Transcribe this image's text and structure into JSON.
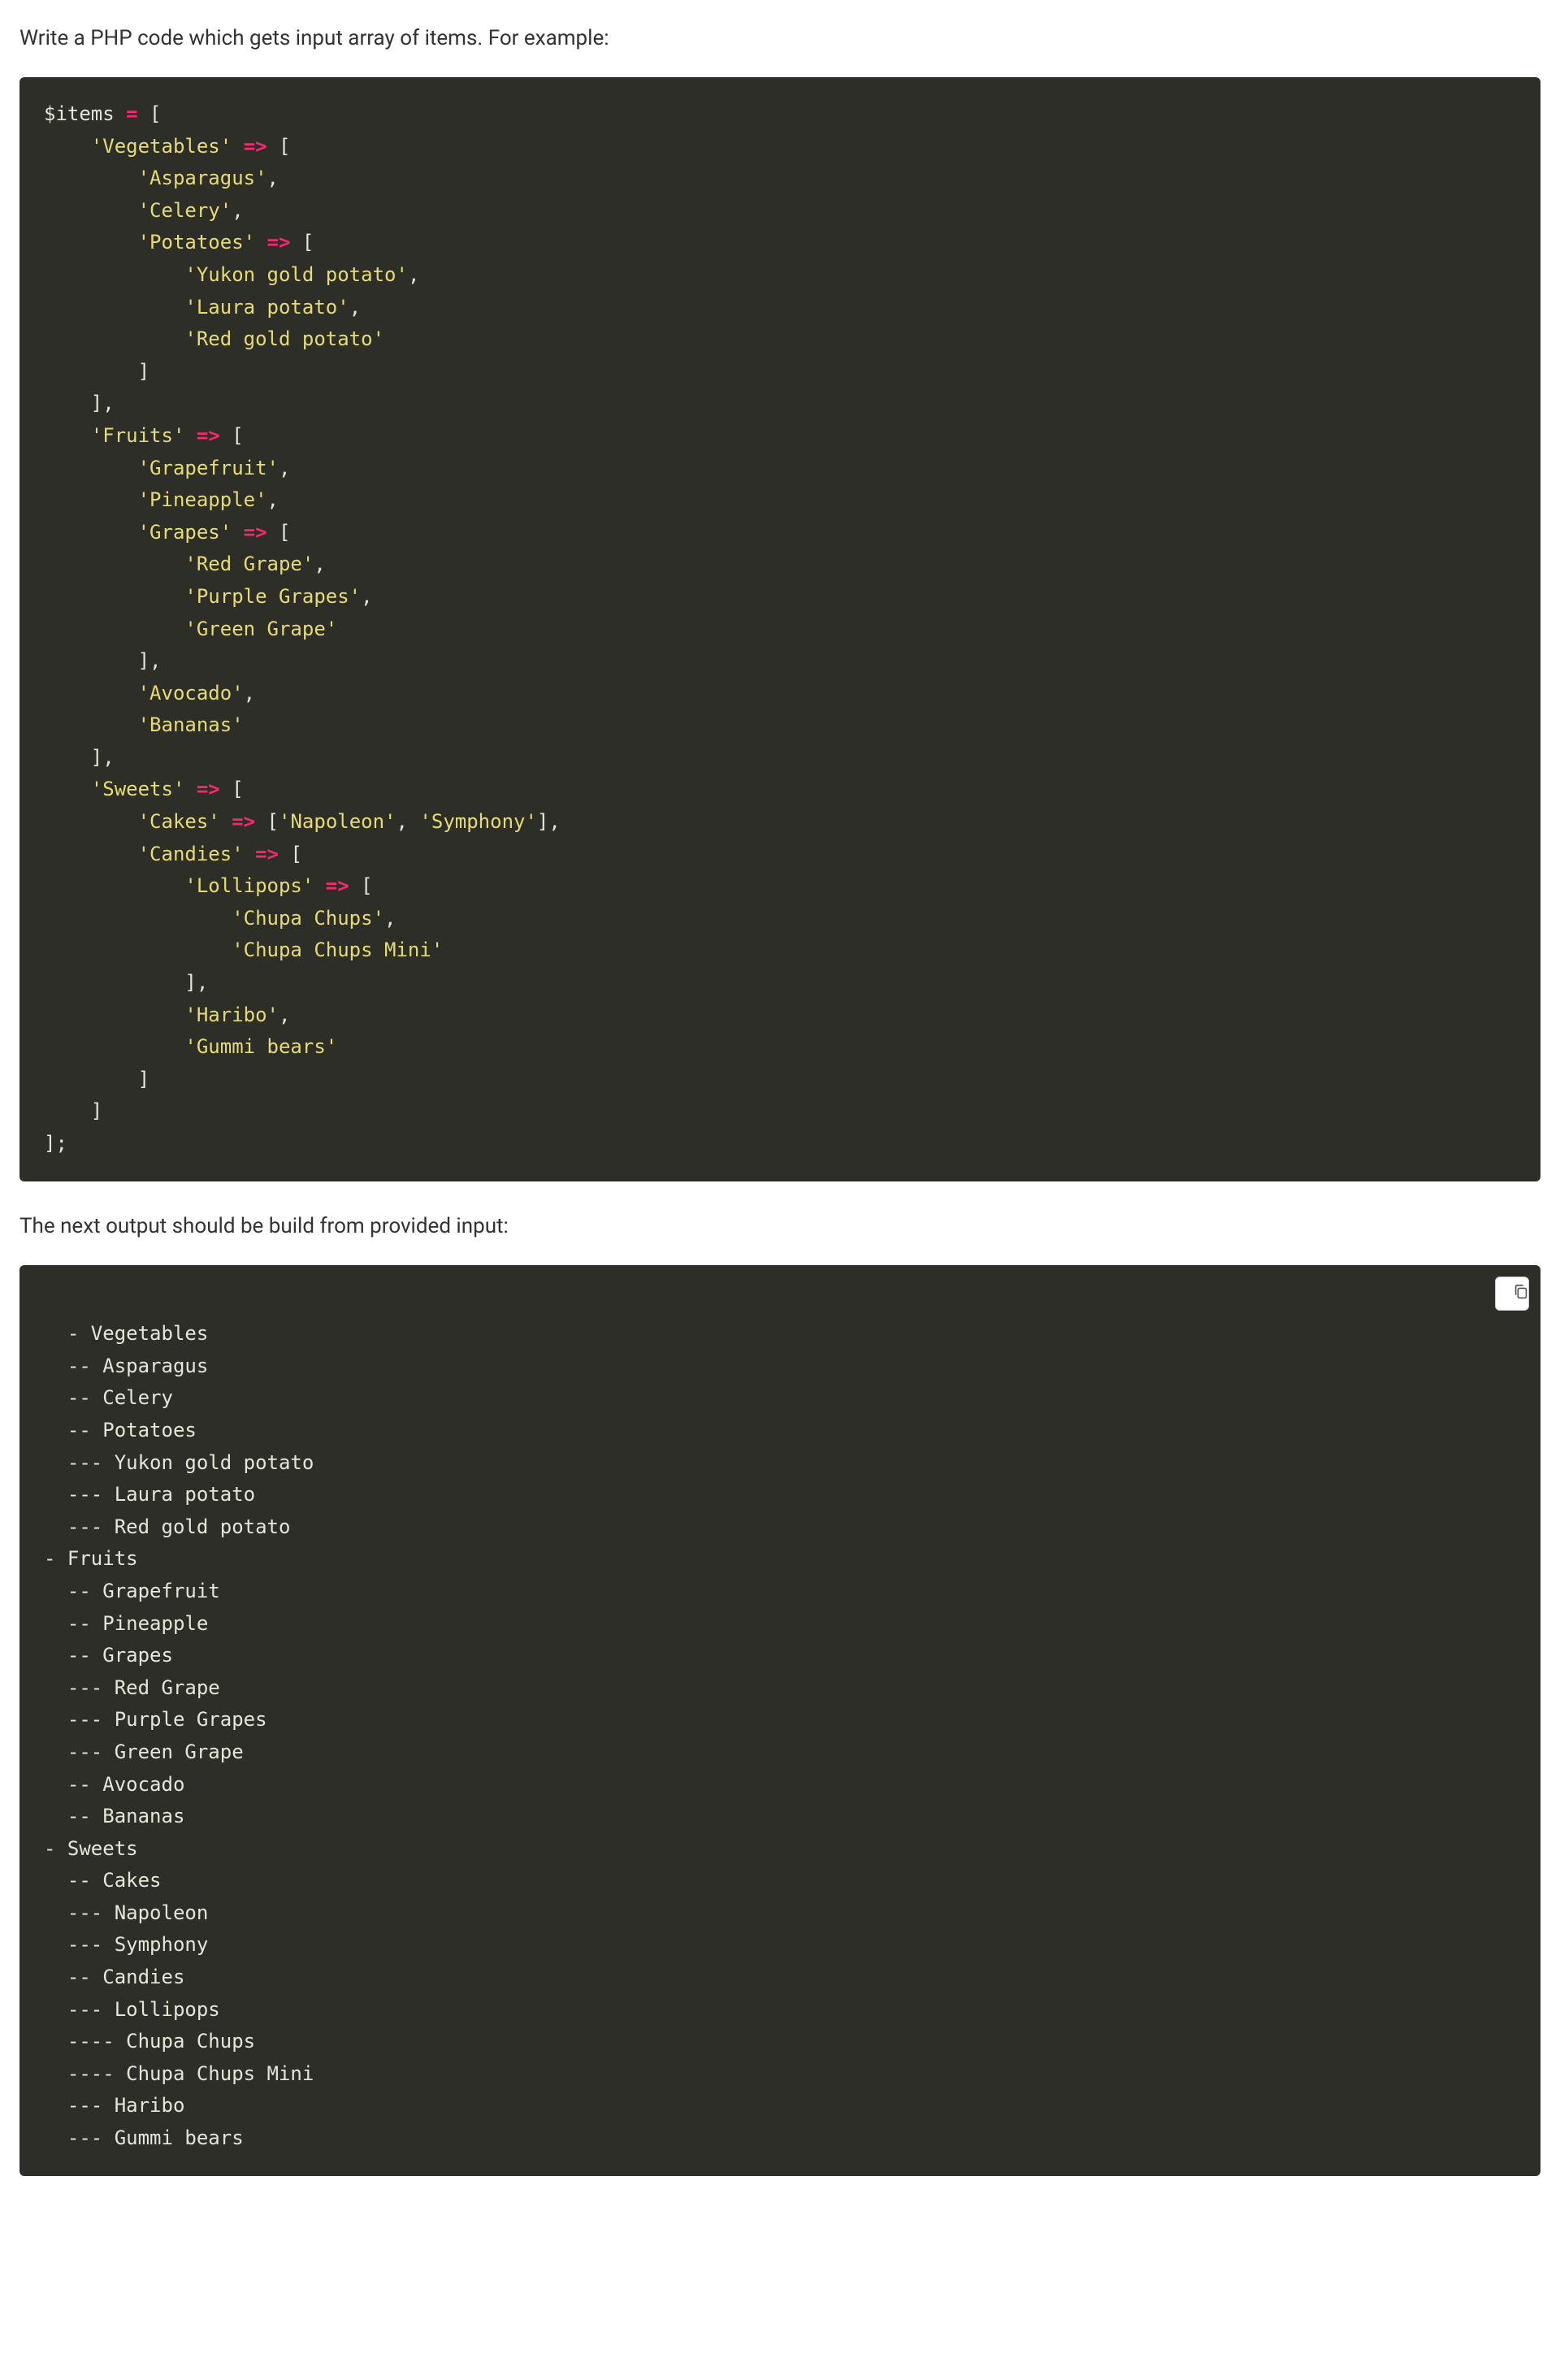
{
  "instruction_top": "Write a PHP code which gets input array of items. For example:",
  "instruction_mid": "The next output should be build from provided input:",
  "copy_button_label": "Copy",
  "code_block_1_tokens": [
    [
      "var",
      "$items"
    ],
    [
      "punct",
      " "
    ],
    [
      "eq",
      "="
    ],
    [
      "punct",
      " ["
    ],
    [
      "punct",
      "\n"
    ],
    [
      "punct",
      "    "
    ],
    [
      "str",
      "'Vegetables'"
    ],
    [
      "punct",
      " "
    ],
    [
      "arrow",
      "=>"
    ],
    [
      "punct",
      " ["
    ],
    [
      "punct",
      "\n"
    ],
    [
      "punct",
      "        "
    ],
    [
      "str",
      "'Asparagus'"
    ],
    [
      "punct",
      ","
    ],
    [
      "punct",
      "\n"
    ],
    [
      "punct",
      "        "
    ],
    [
      "str",
      "'Celery'"
    ],
    [
      "punct",
      ","
    ],
    [
      "punct",
      "\n"
    ],
    [
      "punct",
      "        "
    ],
    [
      "str",
      "'Potatoes'"
    ],
    [
      "punct",
      " "
    ],
    [
      "arrow",
      "=>"
    ],
    [
      "punct",
      " ["
    ],
    [
      "punct",
      "\n"
    ],
    [
      "punct",
      "            "
    ],
    [
      "str",
      "'Yukon gold potato'"
    ],
    [
      "punct",
      ","
    ],
    [
      "punct",
      "\n"
    ],
    [
      "punct",
      "            "
    ],
    [
      "str",
      "'Laura potato'"
    ],
    [
      "punct",
      ","
    ],
    [
      "punct",
      "\n"
    ],
    [
      "punct",
      "            "
    ],
    [
      "str",
      "'Red gold potato'"
    ],
    [
      "punct",
      "\n"
    ],
    [
      "punct",
      "        ]"
    ],
    [
      "punct",
      "\n"
    ],
    [
      "punct",
      "    ],"
    ],
    [
      "punct",
      "\n"
    ],
    [
      "punct",
      "    "
    ],
    [
      "str",
      "'Fruits'"
    ],
    [
      "punct",
      " "
    ],
    [
      "arrow",
      "=>"
    ],
    [
      "punct",
      " ["
    ],
    [
      "punct",
      "\n"
    ],
    [
      "punct",
      "        "
    ],
    [
      "str",
      "'Grapefruit'"
    ],
    [
      "punct",
      ","
    ],
    [
      "punct",
      "\n"
    ],
    [
      "punct",
      "        "
    ],
    [
      "str",
      "'Pineapple'"
    ],
    [
      "punct",
      ","
    ],
    [
      "punct",
      "\n"
    ],
    [
      "punct",
      "        "
    ],
    [
      "str",
      "'Grapes'"
    ],
    [
      "punct",
      " "
    ],
    [
      "arrow",
      "=>"
    ],
    [
      "punct",
      " ["
    ],
    [
      "punct",
      "\n"
    ],
    [
      "punct",
      "            "
    ],
    [
      "str",
      "'Red Grape'"
    ],
    [
      "punct",
      ","
    ],
    [
      "punct",
      "\n"
    ],
    [
      "punct",
      "            "
    ],
    [
      "str",
      "'Purple Grapes'"
    ],
    [
      "punct",
      ","
    ],
    [
      "punct",
      "\n"
    ],
    [
      "punct",
      "            "
    ],
    [
      "str",
      "'Green Grape'"
    ],
    [
      "punct",
      "\n"
    ],
    [
      "punct",
      "        ],"
    ],
    [
      "punct",
      "\n"
    ],
    [
      "punct",
      "        "
    ],
    [
      "str",
      "'Avocado'"
    ],
    [
      "punct",
      ","
    ],
    [
      "punct",
      "\n"
    ],
    [
      "punct",
      "        "
    ],
    [
      "str",
      "'Bananas'"
    ],
    [
      "punct",
      "\n"
    ],
    [
      "punct",
      "    ],"
    ],
    [
      "punct",
      "\n"
    ],
    [
      "punct",
      "    "
    ],
    [
      "str",
      "'Sweets'"
    ],
    [
      "punct",
      " "
    ],
    [
      "arrow",
      "=>"
    ],
    [
      "punct",
      " ["
    ],
    [
      "punct",
      "\n"
    ],
    [
      "punct",
      "        "
    ],
    [
      "str",
      "'Cakes'"
    ],
    [
      "punct",
      " "
    ],
    [
      "arrow",
      "=>"
    ],
    [
      "punct",
      " ["
    ],
    [
      "str",
      "'Napoleon'"
    ],
    [
      "punct",
      ", "
    ],
    [
      "str",
      "'Symphony'"
    ],
    [
      "punct",
      "],"
    ],
    [
      "punct",
      "\n"
    ],
    [
      "punct",
      "        "
    ],
    [
      "str",
      "'Candies'"
    ],
    [
      "punct",
      " "
    ],
    [
      "arrow",
      "=>"
    ],
    [
      "punct",
      " ["
    ],
    [
      "punct",
      "\n"
    ],
    [
      "punct",
      "            "
    ],
    [
      "str",
      "'Lollipops'"
    ],
    [
      "punct",
      " "
    ],
    [
      "arrow",
      "=>"
    ],
    [
      "punct",
      " ["
    ],
    [
      "punct",
      "\n"
    ],
    [
      "punct",
      "                "
    ],
    [
      "str",
      "'Chupa Chups'"
    ],
    [
      "punct",
      ","
    ],
    [
      "punct",
      "\n"
    ],
    [
      "punct",
      "                "
    ],
    [
      "str",
      "'Chupa Chups Mini'"
    ],
    [
      "punct",
      "\n"
    ],
    [
      "punct",
      "            ],"
    ],
    [
      "punct",
      "\n"
    ],
    [
      "punct",
      "            "
    ],
    [
      "str",
      "'Haribo'"
    ],
    [
      "punct",
      ","
    ],
    [
      "punct",
      "\n"
    ],
    [
      "punct",
      "            "
    ],
    [
      "str",
      "'Gummi bears'"
    ],
    [
      "punct",
      "\n"
    ],
    [
      "punct",
      "        ]"
    ],
    [
      "punct",
      "\n"
    ],
    [
      "punct",
      "    ]"
    ],
    [
      "punct",
      "\n"
    ],
    [
      "punct",
      "];"
    ]
  ],
  "code_block_2_lines": [
    "- Vegetables",
    "  -- Asparagus",
    "  -- Celery",
    "  -- Potatoes",
    "  --- Yukon gold potato",
    "  --- Laura potato",
    "  --- Red gold potato",
    "- Fruits",
    "  -- Grapefruit",
    "  -- Pineapple",
    "  -- Grapes",
    "  --- Red Grape",
    "  --- Purple Grapes",
    "  --- Green Grape",
    "  -- Avocado",
    "  -- Bananas",
    "- Sweets",
    "  -- Cakes",
    "  --- Napoleon",
    "  --- Symphony",
    "  -- Candies",
    "  --- Lollipops",
    "  ---- Chupa Chups",
    "  ---- Chupa Chups Mini",
    "  --- Haribo",
    "  --- Gummi bears"
  ]
}
